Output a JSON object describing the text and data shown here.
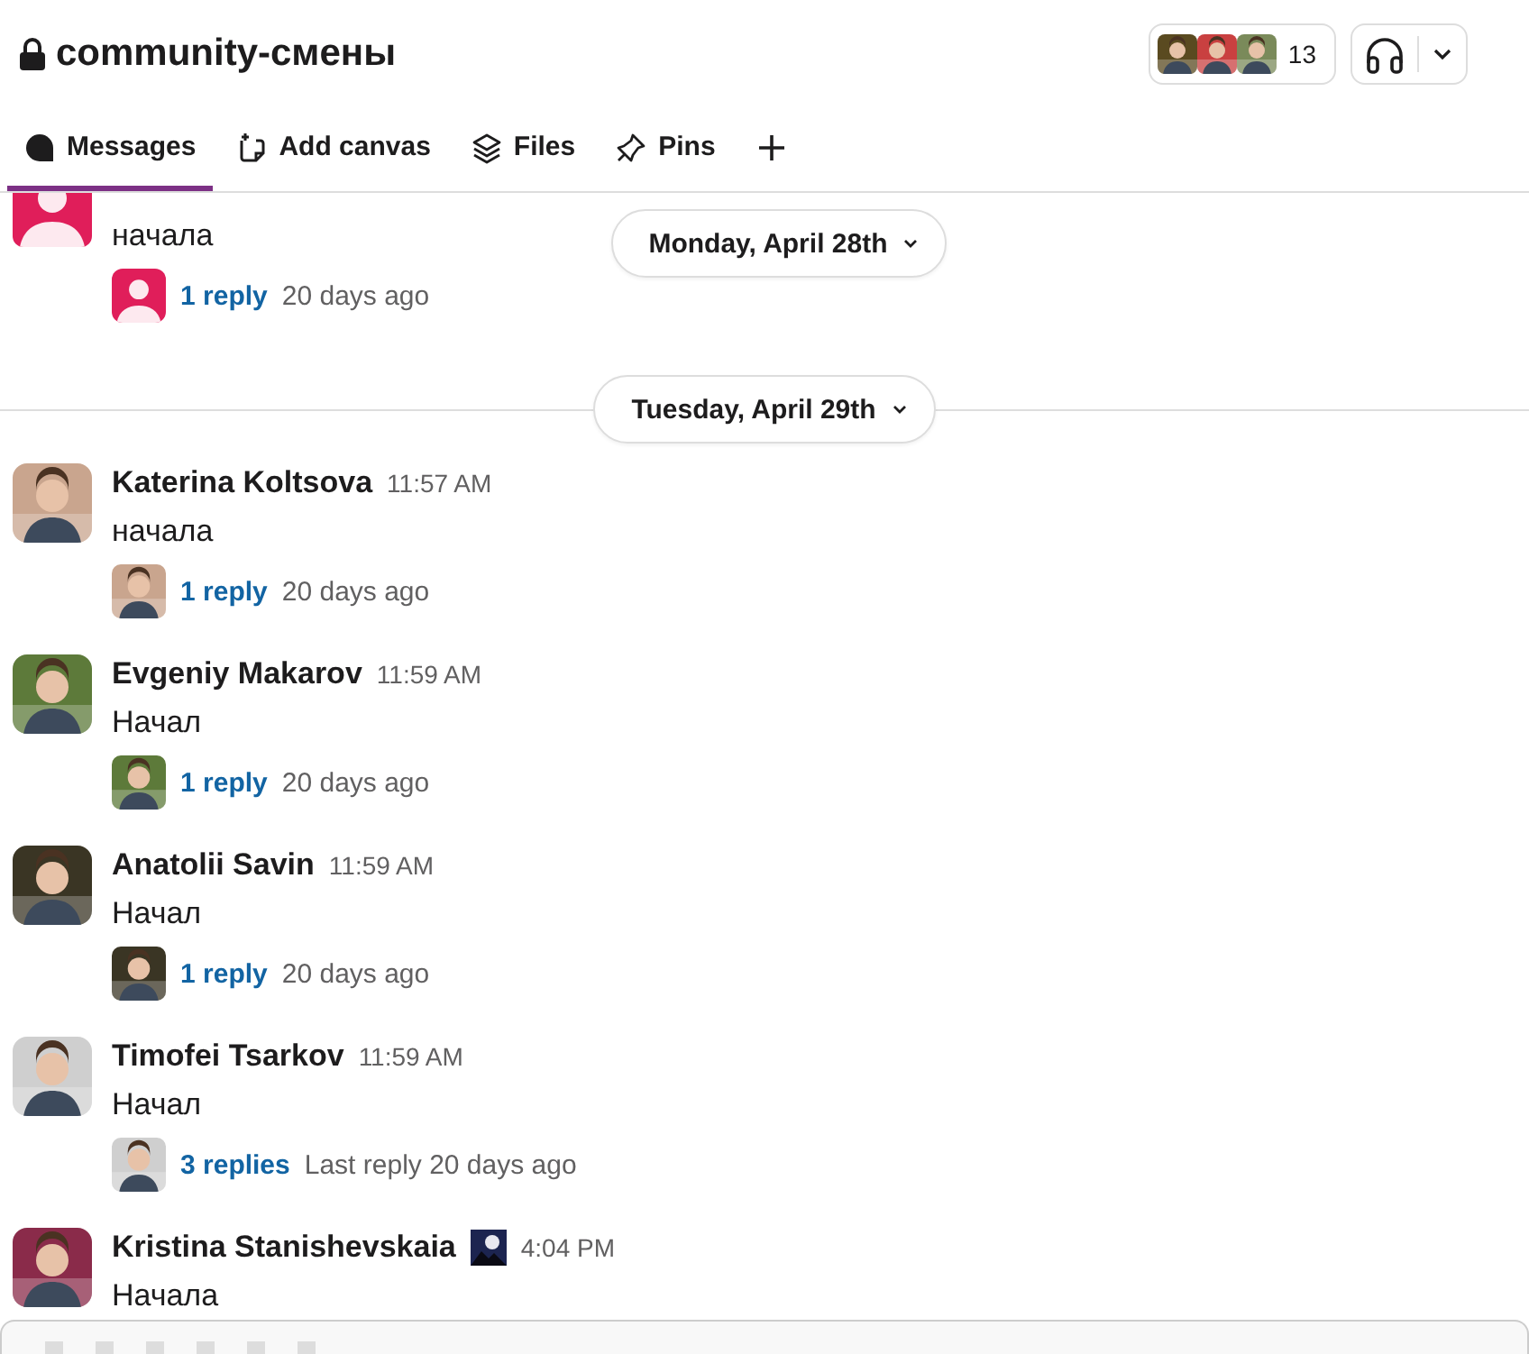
{
  "channel": {
    "title": "community-смены",
    "member_count": "13"
  },
  "tabs": [
    {
      "label": "Messages",
      "selected": true
    },
    {
      "label": "Add canvas",
      "selected": false
    },
    {
      "label": "Files",
      "selected": false
    },
    {
      "label": "Pins",
      "selected": false
    }
  ],
  "sticky_date": {
    "label": "Monday, April 28th"
  },
  "partial_message": {
    "text": "начала",
    "reply_count": "1 reply",
    "reply_time": "20 days ago"
  },
  "date_divider": {
    "label": "Tuesday, April 29th"
  },
  "messages": [
    {
      "author": "Katerina Koltsova",
      "time": "11:57 AM",
      "text": "начала",
      "reply_count": "1 reply",
      "reply_time": "20 days ago"
    },
    {
      "author": "Evgeniy Makarov",
      "time": "11:59 AM",
      "text": "Начал",
      "reply_count": "1 reply",
      "reply_time": "20 days ago"
    },
    {
      "author": "Anatolii Savin",
      "time": "11:59 AM",
      "text": "Начал",
      "reply_count": "1 reply",
      "reply_time": "20 days ago"
    },
    {
      "author": "Timofei Tsarkov",
      "time": "11:59 AM",
      "text": "Начал",
      "reply_count": "3 replies",
      "reply_time": "Last reply 20 days ago"
    },
    {
      "author": "Kristina Stanishevskaia",
      "time": "4:04 PM",
      "text": "Начала",
      "status_emoji": true
    }
  ]
}
